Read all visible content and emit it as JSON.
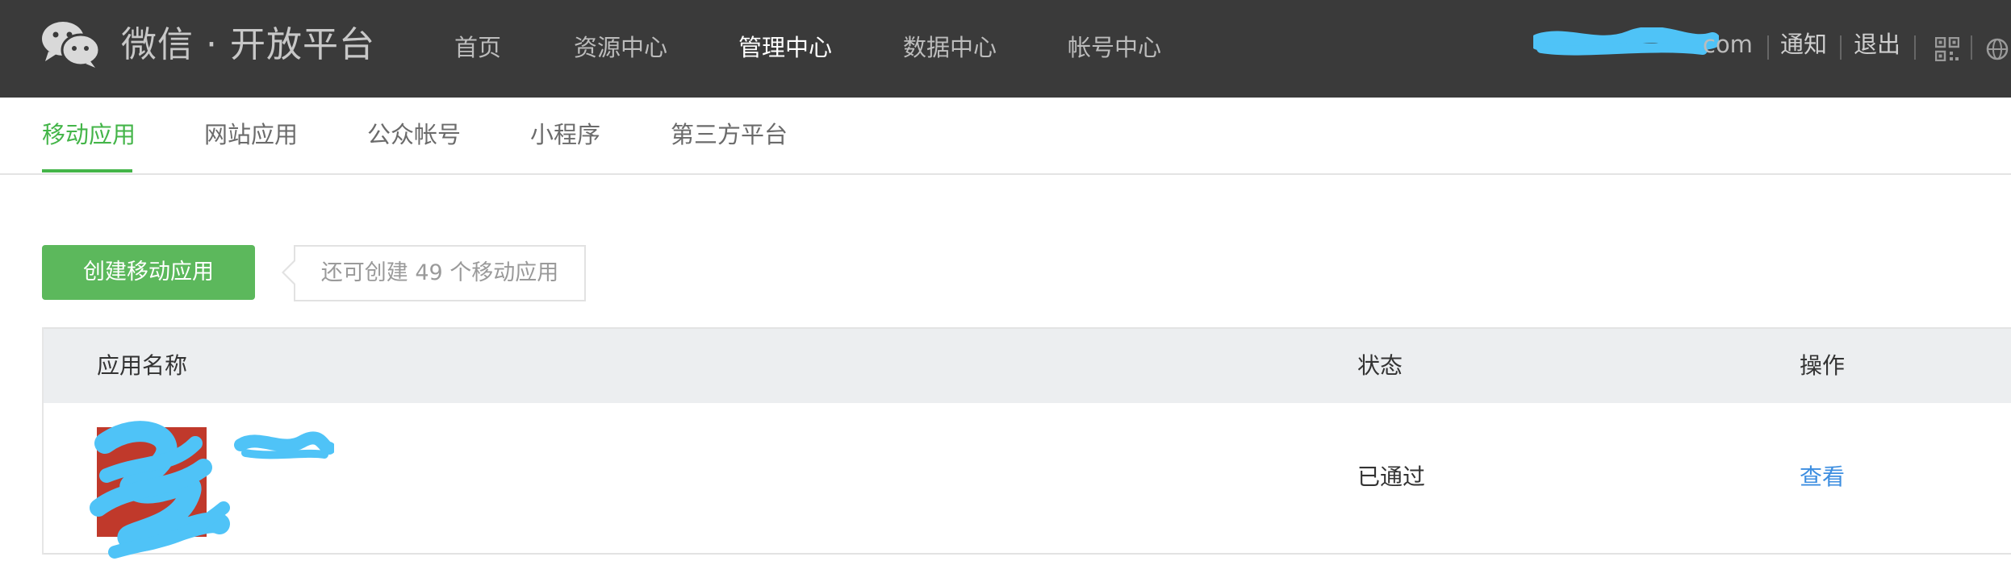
{
  "header": {
    "brand": "微信 · 开放平台",
    "nav": [
      "首页",
      "资源中心",
      "管理中心",
      "数据中心",
      "帐号中心"
    ],
    "active_nav": "管理中心",
    "account_suffix": "com",
    "notify": "通知",
    "logout": "退出"
  },
  "subtabs": {
    "items": [
      "移动应用",
      "网站应用",
      "公众帐号",
      "小程序",
      "第三方平台"
    ],
    "active": "移动应用"
  },
  "create": {
    "button_label": "创建移动应用",
    "tip": "还可创建 49 个移动应用"
  },
  "table": {
    "headers": [
      "应用名称",
      "状态",
      "操作"
    ],
    "rows": [
      {
        "status": "已通过",
        "action": "查看"
      }
    ]
  },
  "colors": {
    "header_bg": "#3a3a3a",
    "accent_green": "#44b549",
    "button_green": "#5cb85c",
    "link_blue": "#3d8ee0",
    "redaction_blue": "#4fc3f7"
  }
}
